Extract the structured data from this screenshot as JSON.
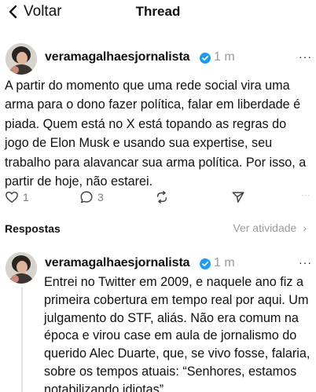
{
  "header": {
    "back_label": "Voltar",
    "title": "Thread"
  },
  "post": {
    "username": "veramagalhaesjornalista",
    "time": "1 m",
    "more": "···",
    "text": "A partir do momento que uma rede social vira uma arma para o dono fazer política, falar em liberdade é piada. Quem está no X está topando as regras do jogo de Elon Musk e usando sua expertise, seu trabalho para alavancar sua arma política. Por isso, a partir de hoje, não estarei.",
    "likes": "1",
    "comments": "3",
    "overflow": "···"
  },
  "replies_section": {
    "label": "Respostas",
    "filter_label": "Ver atividade",
    "filter_chevron": "›"
  },
  "reply": {
    "username": "veramagalhaesjornalista",
    "time": "1 m",
    "more": "···",
    "text": "Entrei no Twitter em 2009, e naquele ano fiz a primeira cobertura em tempo real por aqui. Um julgamento do STF, aliás. Não era comum na época e virou case em aula de jornalismo do querido Alec Duarte, que, se vivo fosse, falaria, sobre os tempos atuais: “Senhores, estamos notabilizando idiotas”."
  },
  "colors": {
    "verified_blue": "#1d9bf0",
    "muted": "#9a9a9a",
    "divider": "#e6e6e6"
  },
  "icons": [
    "chevron-left-icon",
    "verified-badge-icon",
    "heart-icon",
    "comment-icon",
    "repost-icon",
    "share-icon"
  ]
}
